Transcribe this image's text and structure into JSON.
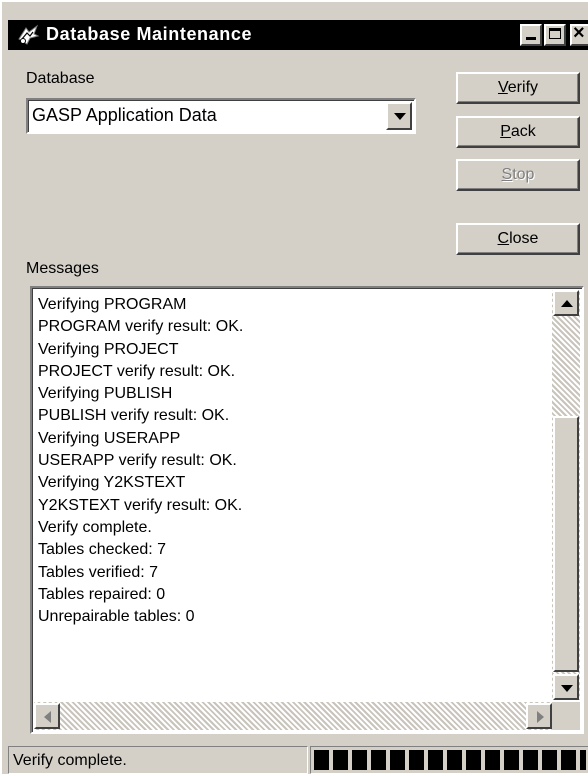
{
  "window": {
    "title": "Database Maintenance",
    "title_icon": "database-maintenance-icon",
    "min_label": "_",
    "close_label": "×"
  },
  "database": {
    "label": "Database",
    "selected": "GASP Application Data"
  },
  "buttons": {
    "verify": {
      "accel": "V",
      "rest": "erify"
    },
    "pack": {
      "accel": "P",
      "rest": "ack"
    },
    "stop": {
      "accel": "S",
      "rest": "top",
      "enabled": false
    },
    "close": {
      "accel": "C",
      "rest": "lose"
    }
  },
  "messages": {
    "label": "Messages",
    "lines": [
      "Verifying PROGRAM",
      "PROGRAM verify result: OK.",
      "Verifying PROJECT",
      "PROJECT verify result: OK.",
      "Verifying PUBLISH",
      "PUBLISH verify result: OK.",
      "Verifying USERAPP",
      "USERAPP verify result: OK.",
      "Verifying Y2KSTEXT",
      "Y2KSTEXT verify result: OK.",
      "Verify complete.",
      "Tables checked: 7",
      "Tables verified: 7",
      "Tables repaired: 0",
      "Unrepairable tables: 0"
    ]
  },
  "status": {
    "text": "Verify complete.",
    "progress": 1.0
  },
  "colors": {
    "face": "#d4d0c8",
    "titlebar": "#000000",
    "progress_block": "#000000"
  }
}
